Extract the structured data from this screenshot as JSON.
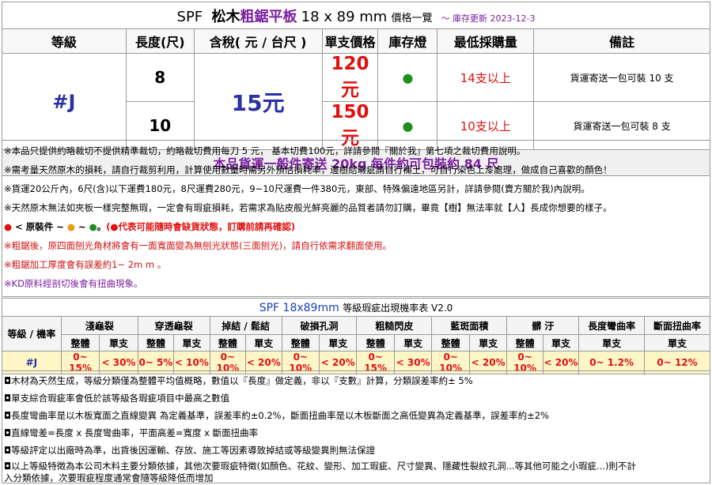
{
  "header": {
    "brand": "SPF",
    "name_prefix": "松木",
    "name_highlight": "粗鋸平板",
    "dimension": "18 x 89 mm",
    "title_suffix": "價格一覽",
    "update": "～ 庫存更新 2023-12-3"
  },
  "columns": [
    "等級",
    "長度(尺)",
    "含稅( 元 / 台尺 )",
    "單支價格",
    "庫存燈",
    "最低採購量",
    "備註"
  ],
  "grade": "#J",
  "price_per_unit": "15元",
  "rows": [
    {
      "length": "8",
      "unit_price": "120元",
      "stock": "●",
      "min_qty": "14支以上",
      "remark": "貨運寄送一包可裝 10 支"
    },
    {
      "length": "10",
      "unit_price": "150元",
      "stock": "●",
      "min_qty": "10支以上",
      "remark": "貨運寄送一包可裝 8 支"
    }
  ],
  "shipping_note": "本品貨運一般件寄送 20kg 每件約可包裝約 84 尺",
  "notes": [
    "※本品只提供約略裁切不提供精準裁切，約略裁切費用每刀 5 元， 基本切費100元，詳請參閱『關於我』第七項之裁切費用說明。",
    "※需考量天然原木的損耗，請自行裁剪利用，計算使用數量時需另外預估損耗率，邊樹結瑕疵請自行補土，可自行染色上漆處理，做成自己喜歡的顏色！",
    "※貨運20公斤內，6尺(含)以下運費180元，8尺運費280元，9~10尺運費一件380元，東部、特殊偏遠地區另計，詳請參閱(賣方關於我)內說明。",
    "※天然原木無法如夾板一樣完整無瑕，一定會有瑕疵損耗，若需求為貼皮般光鮮亮麗的品質者請勿訂購，畢竟【樹】無法率就【人】長成你想要的樣子。"
  ],
  "legend": {
    "label": "< 原裝件  ~",
    "sep": "~",
    "end": "。",
    "caption": "代表可能隨時會缺貨狀態，訂購前請再確認)",
    "open_paren": "("
  },
  "notes_red": [
    "※粗鋸後，原四面刨光角材將會有一面寬面變為無刨光狀態(三面刨光)，請自行依需求翻面使用。",
    "※粗鋸加工厚度會有誤差約1~ 2m m 。"
  ],
  "notes_purple": [
    "※KD原料經剖切後會有扭曲現象。"
  ],
  "defect_table": {
    "title_main": "SPF 18x89mm",
    "title_sub": "等級瑕疵出現機率表 V2.0",
    "corner": "等級 / 機率",
    "groups": [
      "淺龜裂",
      "穿透龜裂",
      "掉結 / 鬆結",
      "破損孔洞",
      "粗糙閃皮",
      "藍斑面積",
      "髒 汙",
      "長度彎曲率",
      "斷面扭曲率"
    ],
    "sub_whole": "整體",
    "sub_single": "單支",
    "row": {
      "grade": "#J",
      "values": [
        "0~ 15%",
        "< 30%",
        "0~ 5%",
        "< 10%",
        "0~ 10%",
        "< 20%",
        "0~ 10%",
        "< 20%",
        "0~ 15%",
        "< 30%",
        "0~ 10%",
        "< 20%",
        "0~ 10%",
        "< 20%",
        "0~ 1.2%",
        "0~ 12%"
      ]
    }
  },
  "footnotes": [
    "◘木材為天然生成，等級分類僅為整體平均值概略，數值以『長度』做定義，非以『支數』計算，分類誤差率約± 5%",
    "◘單支綜合瑕疵率會低於該等級各瑕疵項目中最高之數值",
    "◘長度彎曲率是以木板寬面之直線變異 為定義基準，誤差率約±0.2%，斷面扭曲率是以木板斷面之高低變異為定義基準，誤差率約±2%",
    "◘直線彎差=長度 x 長度彎曲率，平面高差=寬度 x 斷面扭曲率",
    "◘等級評定以出廠時為準，出貨後因運輸、存放、施工等因素導致掉結或等級變異則無法保證",
    "◘以上等級特徵為本公司木料主要分類依據，其他次要瑕疵特徵(如顏色、花紋、變形、加工瑕疵、尺寸變異、隱藏性裂紋孔洞...等其他可能之小瑕疵...)則不計",
    "入分類依據，次要瑕疵程度通常會隨等級降低而增加"
  ],
  "colors": {
    "accent_blue": "#2a2fa6",
    "price_red": "#e01010",
    "purple": "#7a1fa0",
    "stock_green": "#1f8f1f",
    "row_highlight": "#fff6c8"
  }
}
